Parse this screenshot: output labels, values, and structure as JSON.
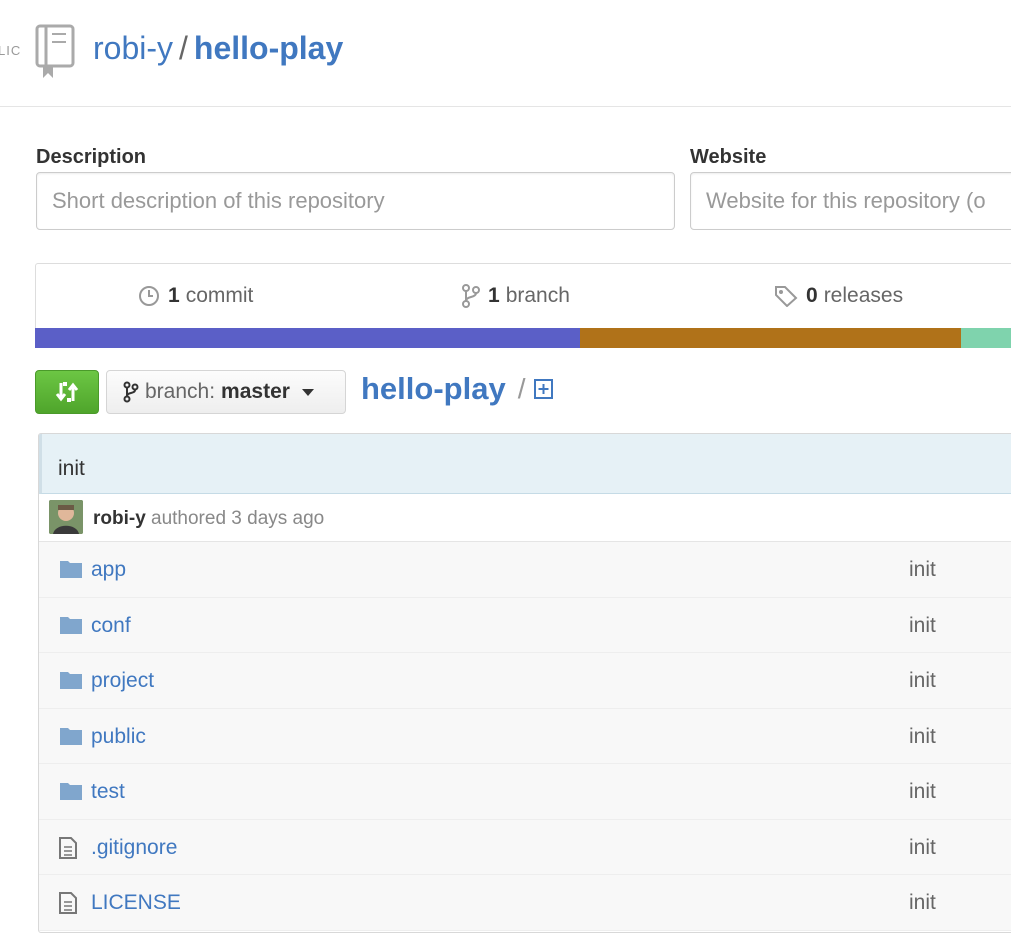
{
  "header": {
    "visibility": "LIC",
    "owner": "robi-y",
    "separator": "/",
    "repo": "hello-play"
  },
  "description": {
    "label": "Description",
    "placeholder": "Short description of this repository"
  },
  "website": {
    "label": "Website",
    "placeholder": "Website for this repository (o"
  },
  "summary": {
    "commits": {
      "count": "1",
      "label": "commit"
    },
    "branches": {
      "count": "1",
      "label": "branch"
    },
    "releases": {
      "count": "0",
      "label": "releases"
    }
  },
  "language_bar": {
    "colors": [
      "#5b5fc7",
      "#b07219",
      "#7fd3ad"
    ],
    "fractions": [
      0.55,
      0.385,
      0.065
    ]
  },
  "branch_select": {
    "prefix": "branch:",
    "value": "master"
  },
  "breadcrumb": {
    "root": "hello-play",
    "slash": "/"
  },
  "commit": {
    "message": "init",
    "author": "robi-y",
    "meta": "authored 3 days ago"
  },
  "files": [
    {
      "type": "dir",
      "name": "app",
      "message": "init"
    },
    {
      "type": "dir",
      "name": "conf",
      "message": "init"
    },
    {
      "type": "dir",
      "name": "project",
      "message": "init"
    },
    {
      "type": "dir",
      "name": "public",
      "message": "init"
    },
    {
      "type": "dir",
      "name": "test",
      "message": "init"
    },
    {
      "type": "file",
      "name": ".gitignore",
      "message": "init"
    },
    {
      "type": "file",
      "name": "LICENSE",
      "message": "init"
    }
  ],
  "colors": {
    "link": "#4078c0",
    "compare_button": "#6cc644",
    "commit_header_bg": "#e6f1f6"
  }
}
